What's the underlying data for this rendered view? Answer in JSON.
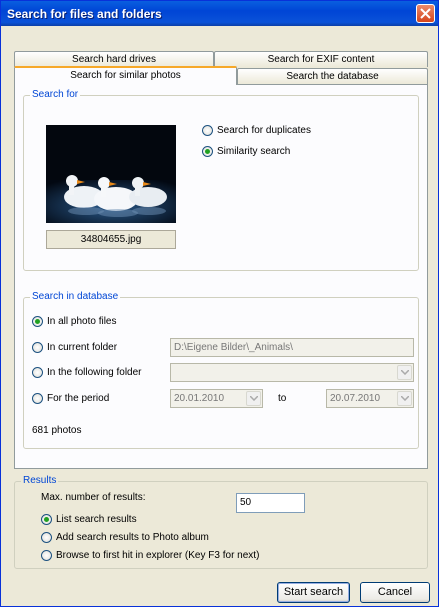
{
  "window": {
    "title": "Search for files and folders"
  },
  "tabs": {
    "row1": [
      "Search hard drives",
      "Search for EXIF content"
    ],
    "row2": [
      "Search for similar photos",
      "Search the database"
    ]
  },
  "search_for": {
    "legend": "Search for",
    "filename": "34804655.jpg",
    "options": [
      "Search for duplicates",
      "Similarity search"
    ],
    "selected": "Similarity search"
  },
  "search_in": {
    "legend": "Search in database",
    "all_files": "In all photo files",
    "current_folder": "In current folder",
    "current_folder_path": "D:\\Eigene Bilder\\_Animals\\",
    "following_folder": "In the following folder",
    "period": "For the period",
    "period_from": "20.01.2010",
    "period_to_label": "to",
    "period_to": "20.07.2010",
    "selected": "In all photo files",
    "count": "681 photos"
  },
  "results": {
    "legend": "Results",
    "max_label": "Max. number of results:",
    "max_value": "50",
    "options": [
      "List search results",
      "Add search results to Photo album",
      "Browse to first hit in explorer (Key F3 for next)"
    ],
    "selected": "List search results"
  },
  "buttons": {
    "start": "Start search",
    "cancel": "Cancel"
  },
  "colors": {
    "titlebar": "#0054e3",
    "legend": "#0046d5",
    "active_tab_accent": "#f6a828"
  }
}
